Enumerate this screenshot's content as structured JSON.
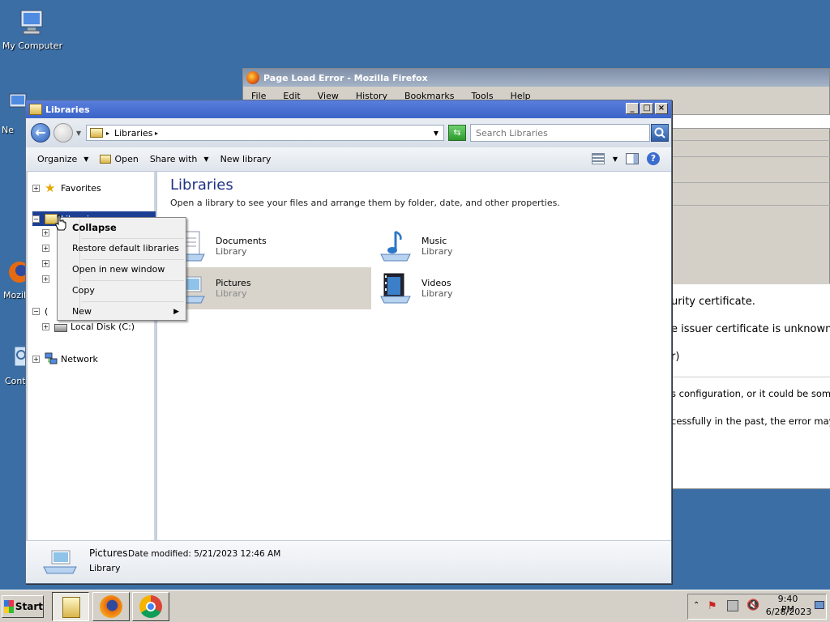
{
  "desktop": {
    "icons": [
      {
        "label": "My Computer",
        "icon": "my-computer-icon"
      },
      {
        "label": "Ne",
        "icon": "network-icon"
      },
      {
        "label": "Mozill",
        "icon": "firefox-icon"
      },
      {
        "label": "Cont",
        "icon": "control-panel-icon"
      }
    ]
  },
  "firefox": {
    "title": "Page Load Error - Mozilla Firefox",
    "menu": [
      "File",
      "Edit",
      "View",
      "History",
      "Bookmarks",
      "Tools",
      "Help"
    ],
    "error_lines": [
      "urity certificate.",
      "e issuer certificate is unknown.",
      "r)",
      "s configuration, or it could be some",
      "cessfully in the past, the error may"
    ]
  },
  "libraries_window": {
    "title": "Libraries",
    "title_buttons": [
      "_",
      "□",
      "×"
    ],
    "breadcrumb": "Libraries",
    "search_placeholder": "Search Libraries",
    "toolbar": {
      "organize": "Organize",
      "open": "Open",
      "share_with": "Share with",
      "new_library": "New library"
    },
    "nav": {
      "favorites": "Favorites",
      "libraries": "Libraries",
      "computer_partial": "(",
      "local_disk": "Local Disk (C:)",
      "network": "Network"
    },
    "heading": "Libraries",
    "description": "Open a library to see your files and arrange them by folder, date, and other properties.",
    "libraries": [
      {
        "name": "Documents",
        "type": "Library",
        "icon": "documents-library-icon"
      },
      {
        "name": "Music",
        "type": "Library",
        "icon": "music-library-icon"
      },
      {
        "name": "Pictures",
        "type": "Library",
        "icon": "pictures-library-icon"
      },
      {
        "name": "Videos",
        "type": "Library",
        "icon": "videos-library-icon"
      }
    ],
    "details": {
      "name": "Pictures",
      "modified": "Date modified:  5/21/2023 12:46 AM",
      "type": "Library"
    }
  },
  "context_menu": {
    "items": [
      "Collapse",
      "Restore default libraries",
      "Open in new window",
      "Copy",
      "New"
    ]
  },
  "taskbar": {
    "start": "Start",
    "time": "9:40 PM",
    "date": "6/28/2023"
  },
  "colors": {
    "desktop": "#3a6ea5",
    "title_active": "#3a64c8",
    "heading": "#1e3287",
    "selection": "#1c3f94"
  }
}
